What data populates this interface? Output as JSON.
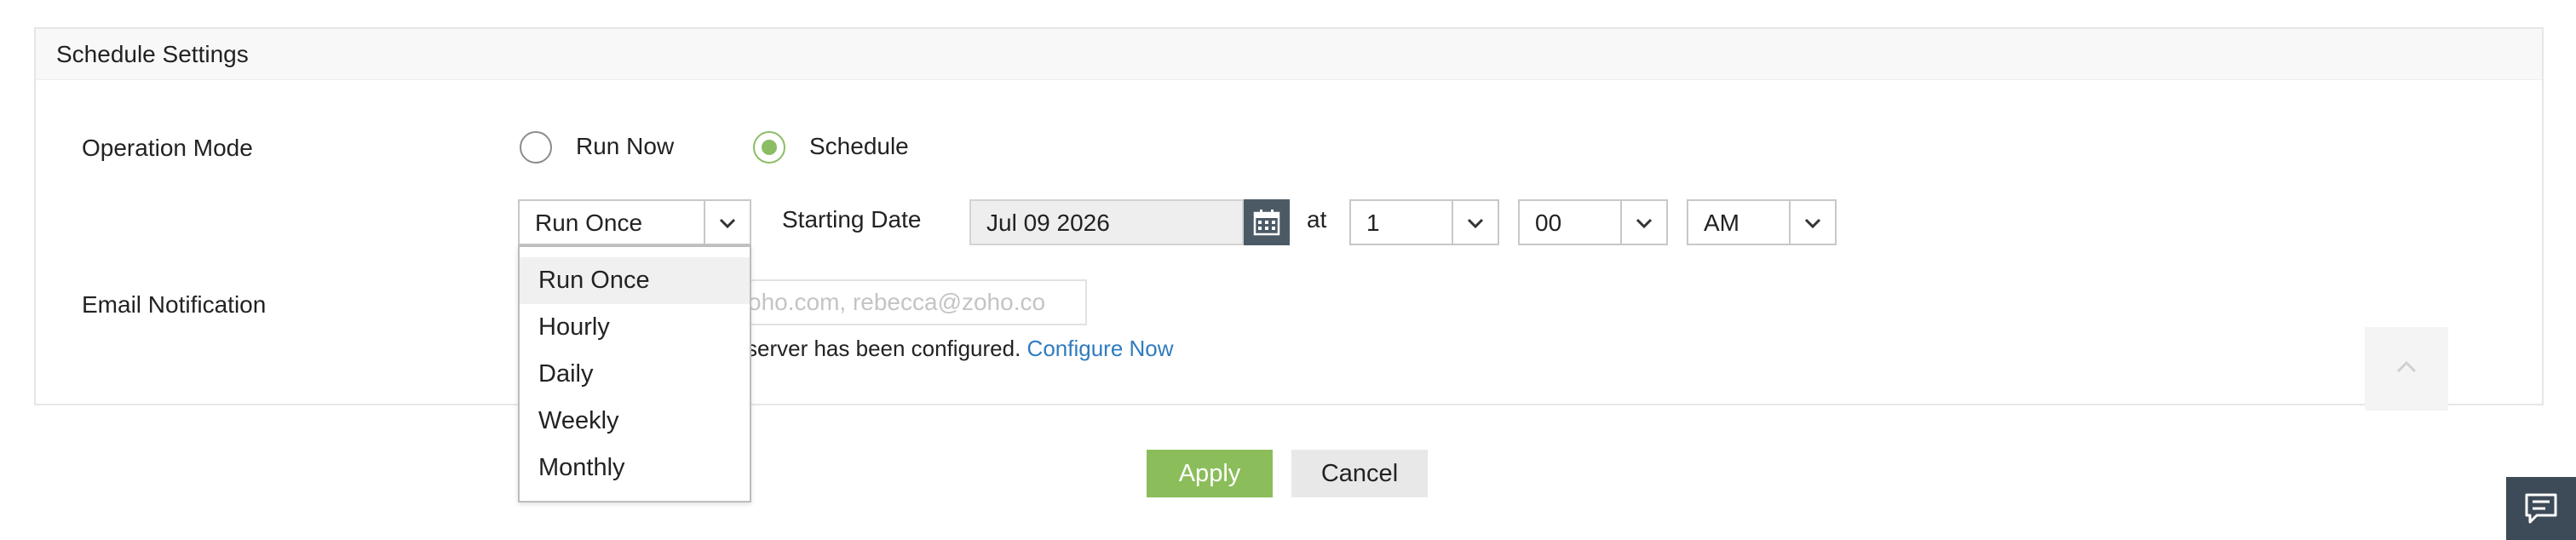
{
  "panel": {
    "title": "Schedule Settings"
  },
  "operation_mode": {
    "label": "Operation Mode",
    "options": [
      "Run Now",
      "Schedule"
    ],
    "selected": "Schedule"
  },
  "schedule": {
    "frequency_value": "Run Once",
    "starting_date_label": "Starting Date",
    "starting_date_value": "Jul 09 2026",
    "at_label": "at",
    "hour_value": "1",
    "minute_value": "00",
    "ampm_value": "AM",
    "frequency_options": [
      "Run Once",
      "Hourly",
      "Daily",
      "Weekly",
      "Monthly"
    ]
  },
  "email": {
    "label": "Email Notification",
    "placeholder": "oho.com, rebecca@zoho.co",
    "note_text": "server has been configured.",
    "note_link": "Configure Now"
  },
  "actions": {
    "apply_label": "Apply",
    "cancel_label": "Cancel"
  },
  "colors": {
    "accent_green": "#8bbd5b",
    "link_blue": "#2f7bbf",
    "dark_slate": "#4c5a66"
  },
  "icons": {
    "calendar": "calendar-icon",
    "chevron_down": "chevron-down-icon",
    "chevron_up": "chevron-up-icon",
    "chat": "chat-icon"
  }
}
